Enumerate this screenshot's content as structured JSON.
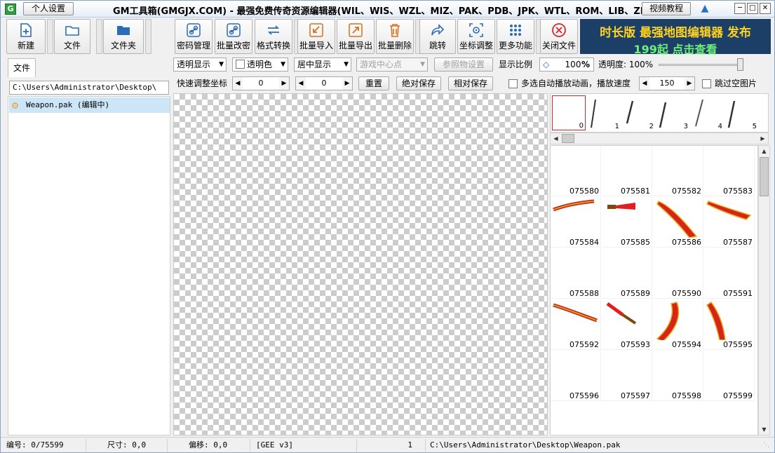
{
  "titlebar": {
    "personal_settings": "个人设置",
    "title": "GM工具箱(GMGJX.COM) - 最强免费传奇资源编辑器(WIL、WIS、WZL、MIZ、PAK、PDB、JPK、WTL、ROM、LIB、ZL)",
    "video_tutorial": "视频教程",
    "icons": [
      "app-icon",
      "shirt-icon",
      "minimize-icon",
      "maximize-icon",
      "close-icon"
    ]
  },
  "toolbar": {
    "new": "新建",
    "file": "文件",
    "folder": "文件夹",
    "password": "密码管理",
    "batch_encrypt": "批量改密",
    "format_convert": "格式转换",
    "batch_import": "批量导入",
    "batch_export": "批量导出",
    "batch_delete": "批量删除",
    "rotate": "跳转",
    "coord_adjust": "坐标调整",
    "more": "更多功能",
    "close_file": "关闭文件"
  },
  "ad": {
    "line1": "时长版 最强地图编辑器 发布",
    "line2": "199起 点击查看"
  },
  "left": {
    "tab": "文件",
    "path": "C:\\Users\\Administrator\\Desktop\\",
    "file_item": "Weapon.pak (编辑中)"
  },
  "options": {
    "display_mode": "透明显示",
    "transparent_color": "透明色",
    "align": "居中显示",
    "game_center": "游戏中心点",
    "ref_settings": "参照物设置",
    "scale_label": "显示比例",
    "scale_value": "100",
    "percent": "%",
    "opacity": "透明度: 100%"
  },
  "coords": {
    "quick_adjust": "快速调整坐标",
    "x": "0",
    "y": "0",
    "reset": "重置",
    "abs_save": "绝对保存",
    "rel_save": "相对保存",
    "auto_play": "多选自动播放动画，播放速度",
    "speed": "150",
    "skip_empty": "跳过空图片"
  },
  "strip": {
    "cells": [
      "0",
      "1",
      "2",
      "3",
      "4",
      "5"
    ]
  },
  "grid": {
    "cells": [
      "075580",
      "075581",
      "075582",
      "075583",
      "075584",
      "075585",
      "075586",
      "075587",
      "075588",
      "075589",
      "075590",
      "075591",
      "075592",
      "075593",
      "075594",
      "075595",
      "075596",
      "075597",
      "075598",
      "075599"
    ]
  },
  "status": {
    "index": "编号: 0/75599",
    "size": "尺寸: 0,0",
    "offset": "偏移: 0,0",
    "format": "[GEE v3]",
    "count": "1",
    "file_path": "C:\\Users\\Administrator\\Desktop\\Weapon.pak"
  },
  "colors": {
    "ad_bg": "#1b3f66",
    "ad_yellow": "#ffd21e",
    "ad_green": "#6ff07a",
    "selected": "#cde6f7",
    "close_red": "#d9252b"
  }
}
